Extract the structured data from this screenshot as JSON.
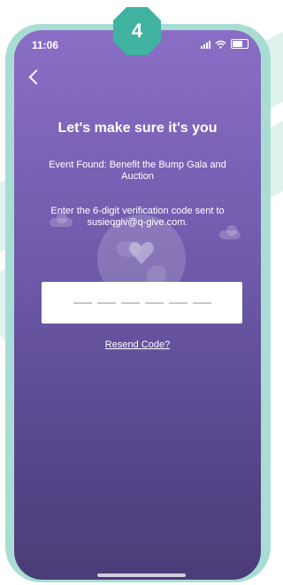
{
  "step": "4",
  "status_bar": {
    "time": "11:06"
  },
  "title": "Let's make sure it's you",
  "event_found": "Event Found: Benefit the Bump Gala and Auction",
  "instructions": "Enter the 6-digit verification code sent to susieqgiv@q-give.com.",
  "code_input": {
    "length": 6,
    "value": ""
  },
  "resend_label": "Resend Code?",
  "colors": {
    "accent": "#3fb39f",
    "screen_top": "#8a6ec6",
    "screen_bottom": "#4b3c78"
  }
}
